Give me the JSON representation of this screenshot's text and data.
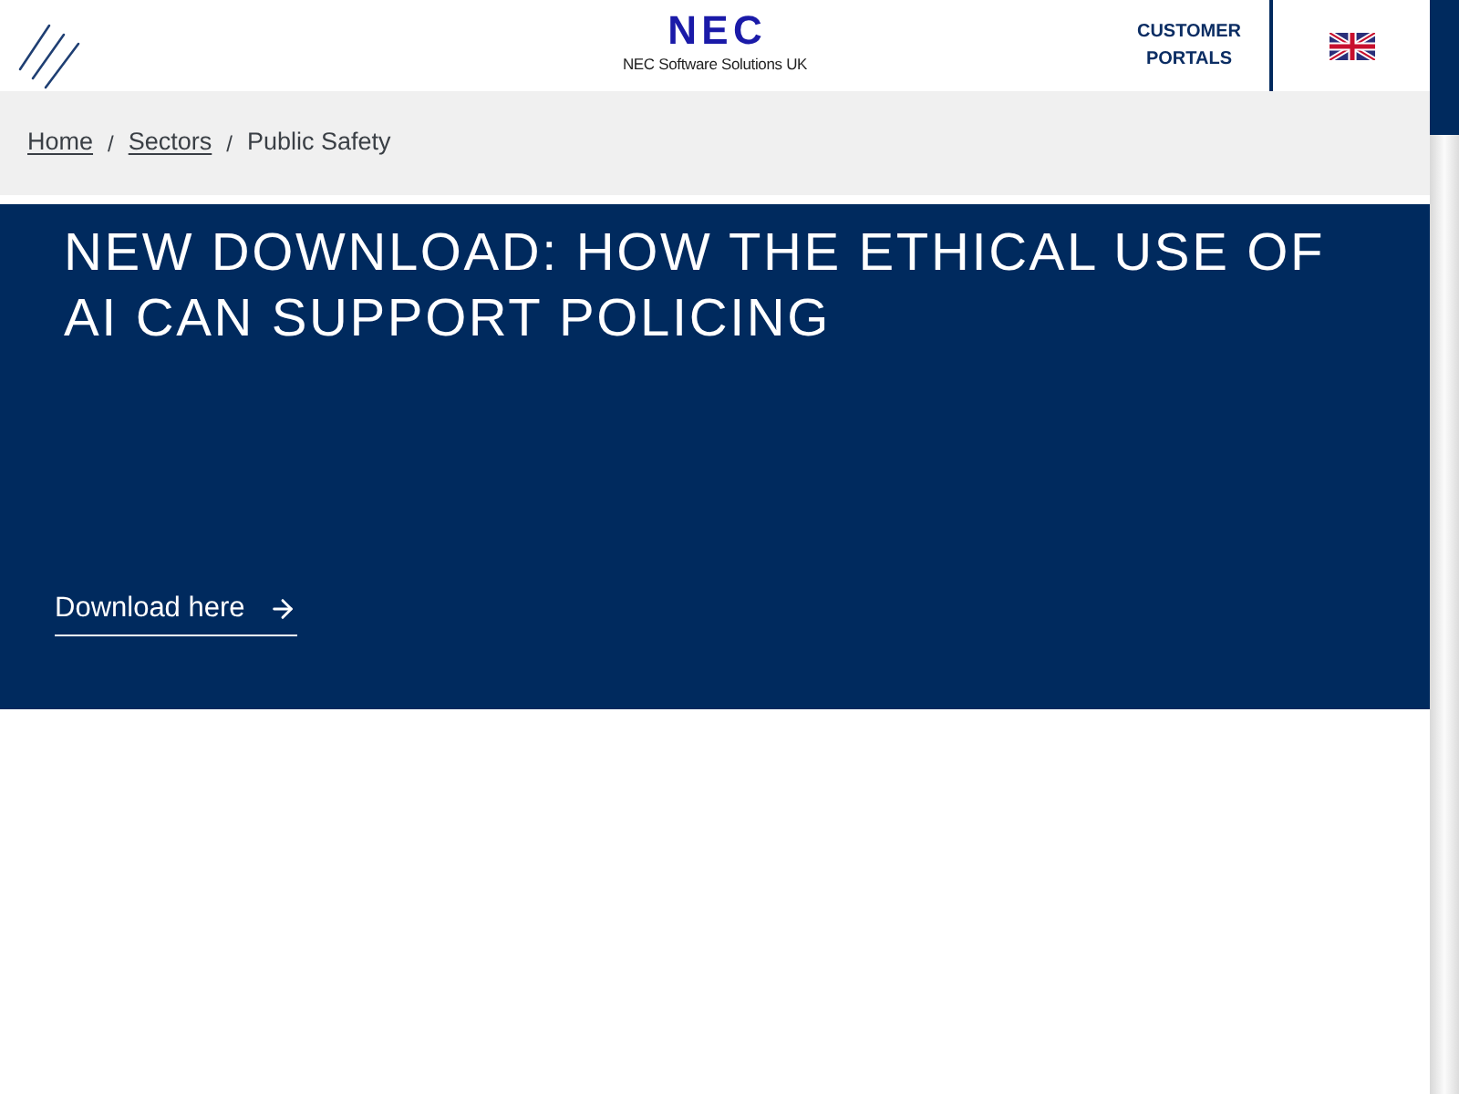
{
  "header": {
    "logo": {
      "wordmark": "NEC",
      "tagline": "NEC Software Solutions UK"
    },
    "customer_portals": "CUSTOMER PORTALS"
  },
  "breadcrumb": [
    {
      "kind": "link",
      "label": "Home"
    },
    {
      "kind": "separator",
      "label": "/"
    },
    {
      "kind": "link",
      "label": "Sectors"
    },
    {
      "kind": "separator",
      "label": "/"
    },
    {
      "kind": "current",
      "label": "Public Safety"
    }
  ],
  "hero": {
    "title": "NEW DOWNLOAD: HOW THE ETHICAL USE OF AI CAN SUPPORT POLICING",
    "cta": "Download here"
  }
}
